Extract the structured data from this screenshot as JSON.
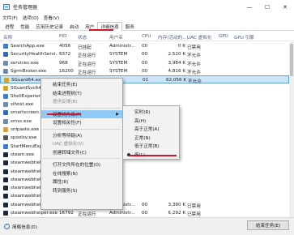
{
  "window": {
    "title": "任务管理器",
    "minimize": "—",
    "maximize": "☐",
    "close": "✕"
  },
  "menubar": [
    "文件(F)",
    "选项(O)",
    "查看(V)"
  ],
  "tabs": [
    {
      "label": "进程",
      "active": false
    },
    {
      "label": "性能",
      "active": false
    },
    {
      "label": "应用历史记录",
      "active": false
    },
    {
      "label": "启动",
      "active": false
    },
    {
      "label": "用户",
      "active": false
    },
    {
      "label": "详细信息",
      "active": true
    },
    {
      "label": "服务",
      "active": false
    }
  ],
  "columns": [
    "名称",
    "PID",
    "状态",
    "用户名",
    "CPU",
    "内存(活动的...)",
    "UAC 虚拟化",
    "GPU",
    "GPU 引擎"
  ],
  "rows": [
    {
      "name": "SearchApp.exe",
      "pid": "4056",
      "status": "已挂起",
      "user": "Administr...",
      "cpu": "00",
      "mem": "0 K",
      "uac": "已禁用",
      "color": "#3b7bd4"
    },
    {
      "name": "SecurityHealthServi...",
      "pid": "6372",
      "status": "正在运行",
      "user": "SYSTEM",
      "cpu": "00",
      "mem": "2,520 K",
      "uac": "不允许",
      "color": "#2f6ab8"
    },
    {
      "name": "services.exe",
      "pid": "968",
      "status": "正在运行",
      "user": "SYSTEM",
      "cpu": "00",
      "mem": "3,984 K",
      "uac": "不允许",
      "color": "#6b8bb0"
    },
    {
      "name": "SgrmBroker.exe",
      "pid": "16200",
      "status": "正在运行",
      "user": "SYSTEM",
      "cpu": "00",
      "mem": "4,816 K",
      "uac": "不允许",
      "color": "#6b8bb0"
    },
    {
      "name": "SGuard64.exe",
      "pid": "",
      "status": "",
      "user": "TEM",
      "cpu": "01",
      "mem": "62,056 K",
      "uac": "不允许",
      "color": "#d9a520",
      "selected": true
    },
    {
      "name": "SGuardSvc64...",
      "pid": "",
      "status": "",
      "user": "",
      "cpu": "",
      "mem": "",
      "uac": "",
      "color": "#d9a520"
    },
    {
      "name": "ShellExperien...",
      "pid": "",
      "status": "",
      "user": "",
      "cpu": "",
      "mem": "",
      "uac": "",
      "color": "#3b7bd4"
    },
    {
      "name": "sihost.exe",
      "pid": "",
      "status": "",
      "user": "",
      "cpu": "",
      "mem": "",
      "uac": "",
      "color": "#6b8bb0"
    },
    {
      "name": "smartscreen.e...",
      "pid": "",
      "status": "",
      "user": "",
      "cpu": "",
      "mem": "",
      "uac": "",
      "color": "#2f6ab8"
    },
    {
      "name": "smss.exe",
      "pid": "",
      "status": "",
      "user": "",
      "cpu": "",
      "mem": "",
      "uac": "",
      "color": "#6b8bb0"
    },
    {
      "name": "snipaste.exe",
      "pid": "",
      "status": "",
      "user": "",
      "cpu": "",
      "mem": "",
      "uac": "",
      "color": "#e0a030"
    },
    {
      "name": "spoolsv.exe",
      "pid": "",
      "status": "",
      "user": "",
      "cpu": "",
      "mem": "",
      "uac": "",
      "color": "#555555"
    },
    {
      "name": "StartMenuExp...",
      "pid": "",
      "status": "",
      "user": "",
      "cpu": "",
      "mem": "",
      "uac": "",
      "color": "#3b7bd4"
    },
    {
      "name": "steam.exe",
      "pid": "",
      "status": "",
      "user": "",
      "cpu": "",
      "mem": "",
      "uac": "",
      "color": "#1b2838"
    },
    {
      "name": "steamwebhelp...",
      "pid": "",
      "status": "",
      "user": "",
      "cpu": "",
      "mem": "",
      "uac": "",
      "color": "#1b2838"
    },
    {
      "name": "steamwebhelp...",
      "pid": "",
      "status": "",
      "user": "",
      "cpu": "",
      "mem": "",
      "uac": "",
      "color": "#1b2838"
    },
    {
      "name": "steamwebhelp...",
      "pid": "",
      "status": "",
      "user": "",
      "cpu": "",
      "mem": "",
      "uac": "",
      "color": "#1b2838"
    },
    {
      "name": "steamwebhelp...",
      "pid": "",
      "status": "",
      "user": "",
      "cpu": "",
      "mem": "",
      "uac": "",
      "color": "#1b2838"
    },
    {
      "name": "steamwebhelp...",
      "pid": "",
      "status": "",
      "user": "",
      "cpu": "",
      "mem": "",
      "uac": "",
      "color": "#1b2838"
    },
    {
      "name": "steamwebhelper.exe",
      "pid": "14716",
      "status": "正在运行",
      "user": "Administr...",
      "cpu": "00",
      "mem": "3,380 K",
      "uac": "已禁用",
      "color": "#1b2838"
    },
    {
      "name": "steamwebhelper.exe",
      "pid": "16792",
      "status": "正在运行",
      "user": "Administr...",
      "cpu": "00",
      "mem": "6,292 K",
      "uac": "已禁用",
      "color": "#1b2838"
    }
  ],
  "context_menu": {
    "items": [
      "结束任务(E)",
      "结束进程树(T)",
      "提供反馈(B)",
      "",
      "设置优先级(P)",
      "设置相关性(F)",
      "",
      "分析等待链(A)",
      "UAC 虚拟化(V)",
      "创建转储文件(C)",
      "",
      "打开文件所在的位置(O)",
      "在线搜索(N)",
      "属性(R)",
      "转到服务(S)"
    ],
    "disabled": [
      2,
      8
    ],
    "highlight": 4,
    "submenu_index": 4
  },
  "submenu": {
    "items": [
      "实时(R)",
      "高(H)",
      "高于正常(A)",
      "正常(N)",
      "低于正常(B)",
      "低(L)"
    ],
    "checked": 5
  },
  "footer": {
    "less_details": "简略信息(D)",
    "end_task": "结束任务(E)"
  },
  "colors": {
    "accent_red": "#d0182a",
    "selection": "#cce4f7",
    "menu_highlight": "#91c9f7"
  }
}
